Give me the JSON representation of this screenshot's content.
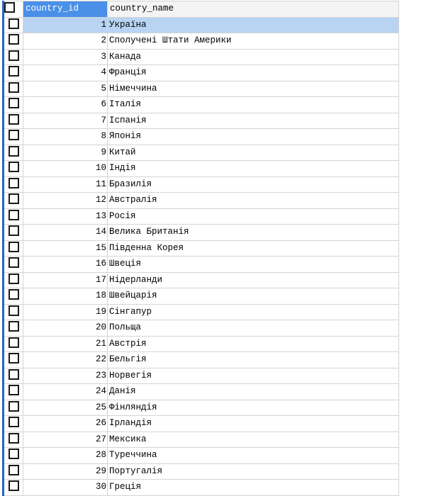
{
  "columns": {
    "id": "country_id",
    "name": "country_name"
  },
  "rows": [
    {
      "id": "1",
      "name": "Україна",
      "selected": true
    },
    {
      "id": "2",
      "name": "Сполучені Штати Америки"
    },
    {
      "id": "3",
      "name": "Канада"
    },
    {
      "id": "4",
      "name": "Франція"
    },
    {
      "id": "5",
      "name": "Німеччина"
    },
    {
      "id": "6",
      "name": "Італія"
    },
    {
      "id": "7",
      "name": "Іспанія"
    },
    {
      "id": "8",
      "name": "Японія"
    },
    {
      "id": "9",
      "name": "Китай"
    },
    {
      "id": "10",
      "name": "Індія"
    },
    {
      "id": "11",
      "name": "Бразилія"
    },
    {
      "id": "12",
      "name": "Австралія"
    },
    {
      "id": "13",
      "name": "Росія"
    },
    {
      "id": "14",
      "name": "Велика Британія"
    },
    {
      "id": "15",
      "name": "Південна Корея"
    },
    {
      "id": "16",
      "name": "Швеція"
    },
    {
      "id": "17",
      "name": "Нідерланди"
    },
    {
      "id": "18",
      "name": "Швейцарія"
    },
    {
      "id": "19",
      "name": "Сінгапур"
    },
    {
      "id": "20",
      "name": "Польща"
    },
    {
      "id": "21",
      "name": "Австрія"
    },
    {
      "id": "22",
      "name": "Бельгія"
    },
    {
      "id": "23",
      "name": "Норвегія"
    },
    {
      "id": "24",
      "name": "Данія"
    },
    {
      "id": "25",
      "name": "Фінляндія"
    },
    {
      "id": "26",
      "name": "Ірландія"
    },
    {
      "id": "27",
      "name": "Мексика"
    },
    {
      "id": "28",
      "name": "Туреччина"
    },
    {
      "id": "29",
      "name": "Португалія"
    },
    {
      "id": "30",
      "name": "Греція"
    }
  ]
}
